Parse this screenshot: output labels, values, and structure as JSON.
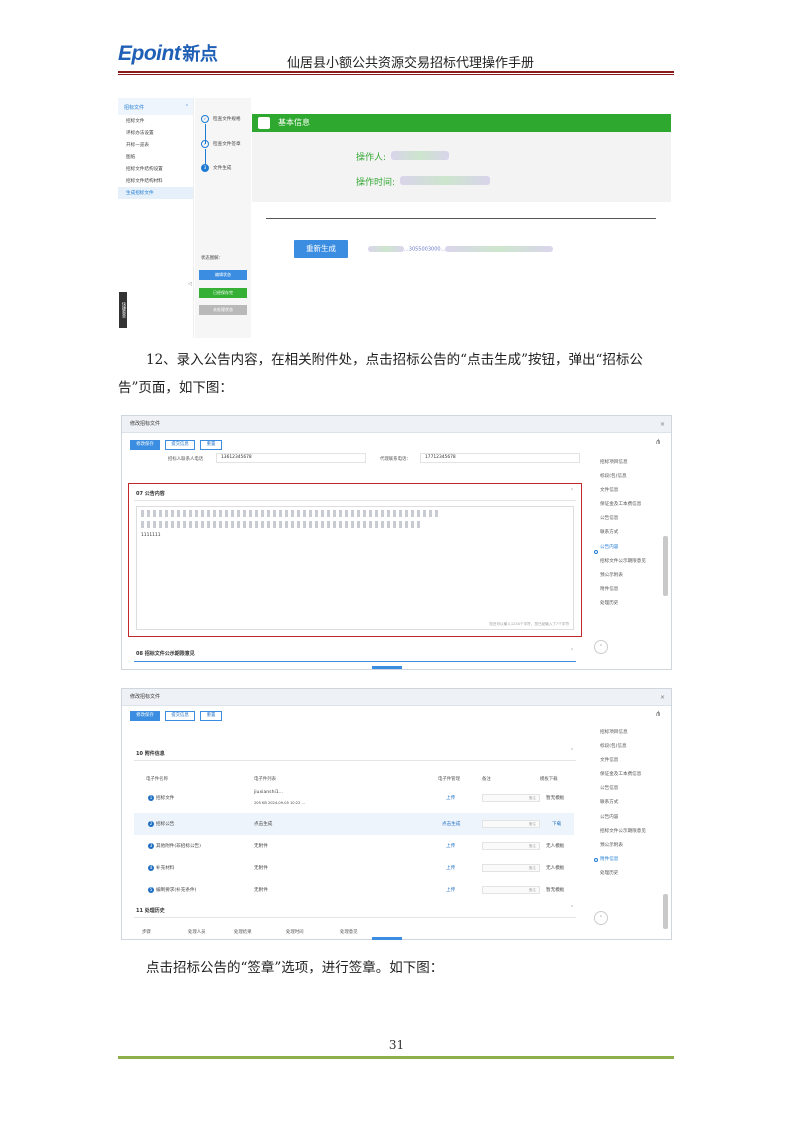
{
  "header": {
    "logo_latin": "Epoint",
    "logo_cn": "新点",
    "title": "仙居县小额公共资源交易招标代理操作手册"
  },
  "paragraphs": {
    "p1_line1": "12、录入公告内容，在相关附件处，点击招标公告的“点击生成”按钮，弹出“招标公",
    "p1_line2": "告”页面，如下图：",
    "p2": "点击招标公告的“签章”选项，进行签章。如下图："
  },
  "footer": {
    "page_number": "31"
  },
  "shot1": {
    "sidebar_group": "招标文件",
    "sidebar_items": [
      "招标文件",
      "评标办法设置",
      "开标一览表",
      "图纸",
      "招标文件结构设置",
      "招标文件结构材料",
      "生成招标文件"
    ],
    "steps": [
      "检查文件规格",
      "检查文件签章",
      "文件生成"
    ],
    "status_label": "状态图解：",
    "status_buttons": [
      "编辑状态",
      "已经保存完",
      "未处理状态"
    ],
    "side_tab": "快捷菜单",
    "info_bar": "基本信息",
    "operator_label": "操作人:",
    "operate_time_label": "操作时间:",
    "regen_button": "重新生成",
    "link_text": "...3055003000..."
  },
  "shot2": {
    "title": "修改招标文件",
    "buttons": [
      "修改保存",
      "提交信息",
      "重置"
    ],
    "field1_label": "招标人联系人电话",
    "field1_value": "13612345678",
    "field2_label": "代理联系电话：",
    "field2_value": "17712345678",
    "section07": "07  公告内容",
    "section08": "08  招标文件公示期限意见",
    "editor_text": "1111111",
    "editor_hint": "您还可以输入1234个字符，您已经输入了7个字符",
    "nav": [
      "招标项目信息",
      "标段(包)信息",
      "文件信息",
      "保证金及工本费信息",
      "公告信息",
      "联系方式",
      "公告内容",
      "招标文件公示期限意见",
      "预公示附表",
      "附件信息",
      "处理历史"
    ],
    "nav_active": "公告内容"
  },
  "shot3": {
    "title": "修改招标文件",
    "buttons": [
      "修改保存",
      "提交信息",
      "重置"
    ],
    "section10": "10  附件信息",
    "section11": "11  处理历史",
    "headers": [
      "电子件名称",
      "电子件列表",
      "电子件管理",
      "备注",
      "模板下载"
    ],
    "rows": [
      {
        "n": "1",
        "name": "招标文件",
        "file": "jiuxianshi1...",
        "file2": "205 KB 2024-09-05 10:22 ...",
        "act": "上传",
        "tpl": "暂无模板"
      },
      {
        "n": "2",
        "name": "招标公告",
        "file": "点击生成",
        "file2": "",
        "act": "点击生成",
        "tpl": "下载"
      },
      {
        "n": "3",
        "name": "其他附件(非招标公告)",
        "file": "无附件",
        "file2": "",
        "act": "上传",
        "tpl": "无人模板"
      },
      {
        "n": "4",
        "name": "补充材料",
        "file": "无附件",
        "file2": "",
        "act": "上传",
        "tpl": "无人模板"
      },
      {
        "n": "5",
        "name": "编制要求(补充条件)",
        "file": "无附件",
        "file2": "",
        "act": "上传",
        "tpl": "暂无模板"
      }
    ],
    "remark_ph": "备注",
    "history_headers": [
      "步骤",
      "处理人员",
      "处理结果",
      "处理时间",
      "处理意见"
    ],
    "nav": [
      "招标项目信息",
      "标段(包)信息",
      "文件信息",
      "保证金及工本费信息",
      "公告信息",
      "联系方式",
      "公告内容",
      "招标文件公示期限意见",
      "预公示附表",
      "附件信息",
      "处理历史"
    ],
    "nav_active": "附件信息"
  }
}
